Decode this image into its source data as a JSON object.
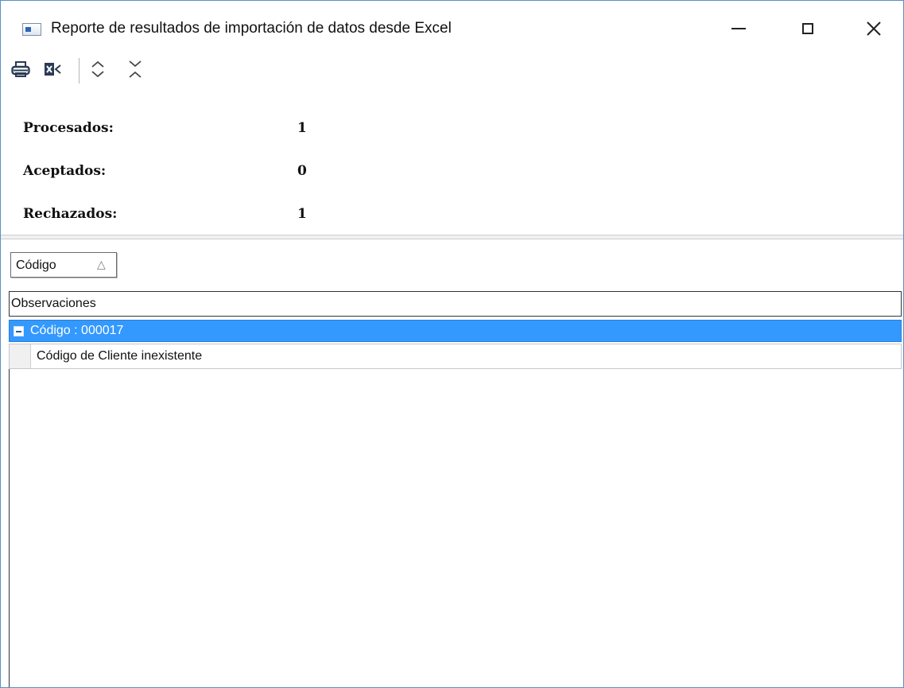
{
  "window": {
    "title": "Reporte de resultados de importación de datos desde Excel"
  },
  "toolbar": {
    "print_icon": "printer-icon",
    "excel_icon": "excel-export-icon",
    "expand_icon": "expand-all-icon",
    "collapse_icon": "collapse-all-icon"
  },
  "summary": {
    "processed_label": "Procesados:",
    "processed_value": "1",
    "accepted_label": "Aceptados:",
    "accepted_value": "0",
    "rejected_label": "Rechazados:",
    "rejected_value": "1"
  },
  "grid": {
    "group_by_chip": "Código",
    "sort_indicator": "△",
    "column_header": "Observaciones",
    "groups": [
      {
        "label": "Código : 000017",
        "rows": [
          "Código de Cliente inexistente"
        ]
      }
    ]
  },
  "colors": {
    "selection": "#3399ff",
    "window_border": "#5a8fc8"
  }
}
